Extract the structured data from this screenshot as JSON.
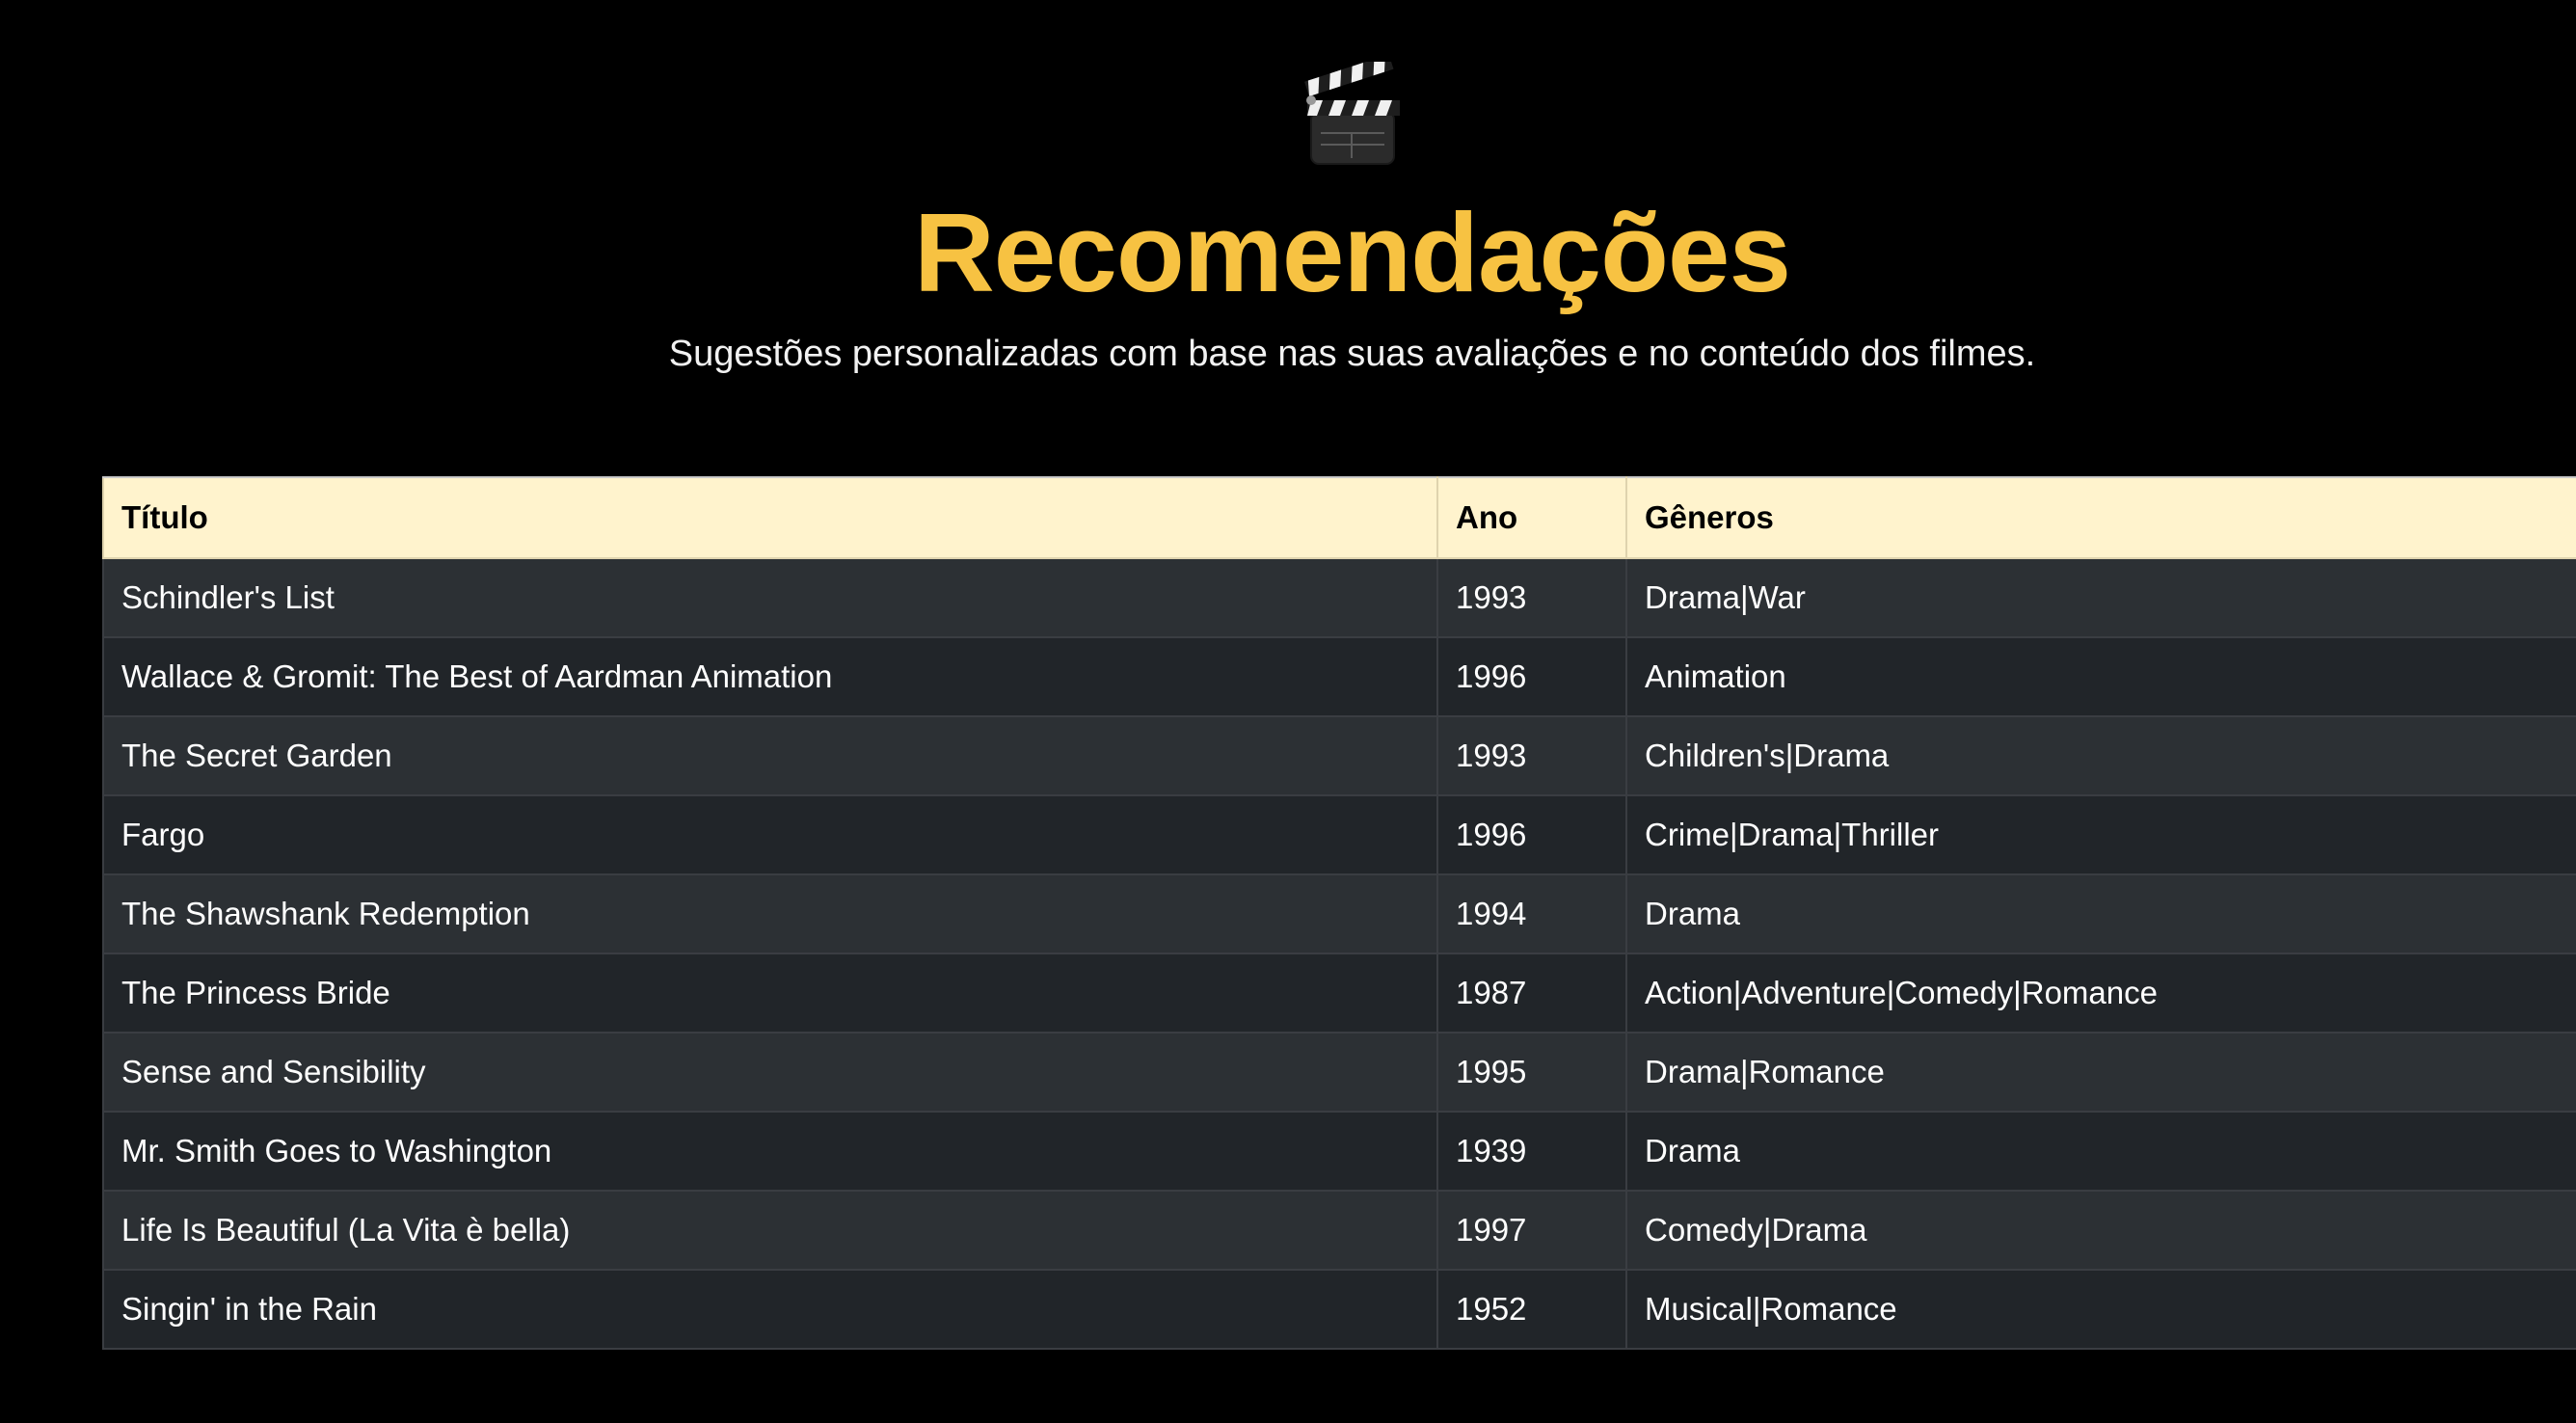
{
  "header": {
    "icon": "clapperboard-icon",
    "title": "Recomendações",
    "subtitle": "Sugestões personalizadas com base nas suas avaliações e no conteúdo dos filmes."
  },
  "colors": {
    "background": "#000000",
    "title": "#f7c242",
    "table_header_bg": "#fff3cd",
    "row_odd_bg": "#2c3034",
    "row_even_bg": "#212529"
  },
  "table": {
    "columns": [
      "Título",
      "Ano",
      "Gêneros"
    ],
    "rows": [
      {
        "title": "Schindler's List",
        "year": "1993",
        "genres": "Drama|War"
      },
      {
        "title": "Wallace & Gromit: The Best of Aardman Animation",
        "year": "1996",
        "genres": "Animation"
      },
      {
        "title": "The Secret Garden",
        "year": "1993",
        "genres": "Children's|Drama"
      },
      {
        "title": "Fargo",
        "year": "1996",
        "genres": "Crime|Drama|Thriller"
      },
      {
        "title": "The Shawshank Redemption",
        "year": "1994",
        "genres": "Drama"
      },
      {
        "title": "The Princess Bride",
        "year": "1987",
        "genres": "Action|Adventure|Comedy|Romance"
      },
      {
        "title": "Sense and Sensibility",
        "year": "1995",
        "genres": "Drama|Romance"
      },
      {
        "title": "Mr. Smith Goes to Washington",
        "year": "1939",
        "genres": "Drama"
      },
      {
        "title": "Life Is Beautiful (La Vita è bella)",
        "year": "1997",
        "genres": "Comedy|Drama"
      },
      {
        "title": "Singin' in the Rain",
        "year": "1952",
        "genres": "Musical|Romance"
      }
    ]
  }
}
